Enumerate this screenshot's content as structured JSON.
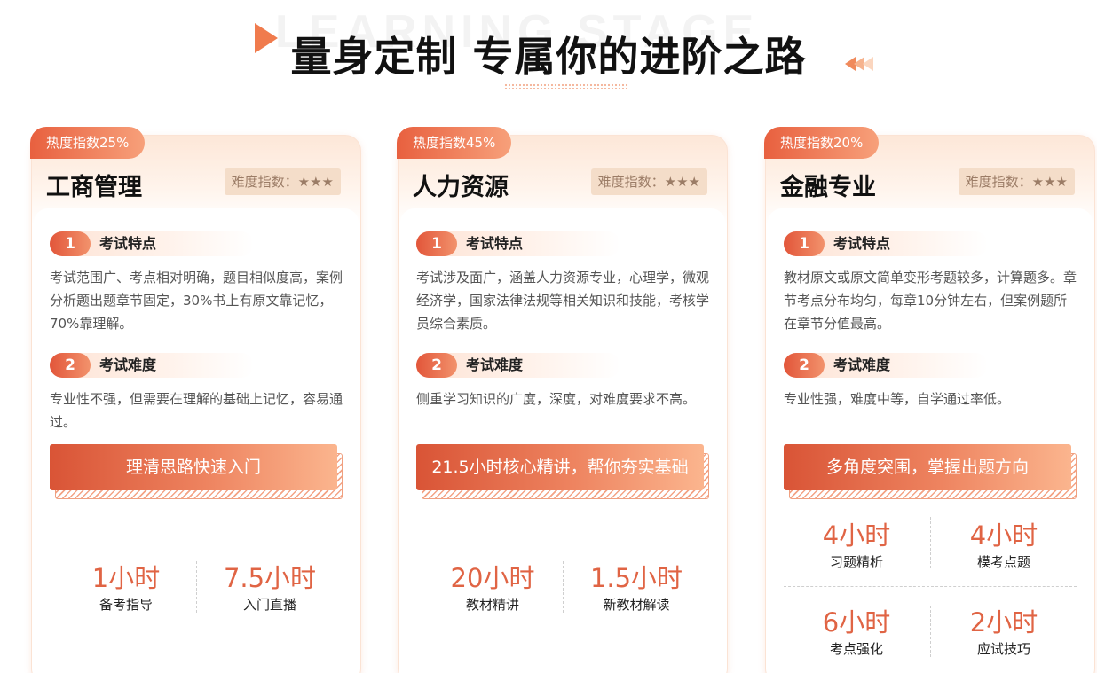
{
  "header": {
    "watermark": "LEARNING STAGE",
    "title": "量身定制 专属你的进阶之路"
  },
  "cards": [
    {
      "heat": "热度指数25%",
      "name": "工商管理",
      "difficulty": "难度指数：★★★",
      "sections": [
        {
          "num": "1",
          "title": "考试特点",
          "text": "考试范围广、考点相对明确，题目相似度高，案例分析题出题章节固定，30%书上有原文靠记忆，70%靠理解。"
        },
        {
          "num": "2",
          "title": "考试难度",
          "text": "专业性不强，但需要在理解的基础上记忆，容易通过。"
        }
      ],
      "button": "理清思路快速入门",
      "stats": [
        {
          "value": "1小时",
          "label": "备考指导"
        },
        {
          "value": "7.5小时",
          "label": "入门直播"
        }
      ]
    },
    {
      "heat": "热度指数45%",
      "name": "人力资源",
      "difficulty": "难度指数：★★★",
      "sections": [
        {
          "num": "1",
          "title": "考试特点",
          "text": "考试涉及面广，涵盖人力资源专业，心理学，微观经济学，国家法律法规等相关知识和技能，考核学员综合素质。"
        },
        {
          "num": "2",
          "title": "考试难度",
          "text": "侧重学习知识的广度，深度，对难度要求不高。"
        }
      ],
      "button": "21.5小时核心精讲，帮你夯实基础",
      "stats": [
        {
          "value": "20小时",
          "label": "教材精讲"
        },
        {
          "value": "1.5小时",
          "label": "新教材解读"
        }
      ]
    },
    {
      "heat": "热度指数20%",
      "name": "金融专业",
      "difficulty": "难度指数：★★★",
      "sections": [
        {
          "num": "1",
          "title": "考试特点",
          "text": "教材原文或原文简单变形考题较多，计算题多。章节考点分布均匀，每章10分钟左右，但案例题所在章节分值最高。"
        },
        {
          "num": "2",
          "title": "考试难度",
          "text": "专业性强，难度中等，自学通过率低。"
        }
      ],
      "button": "多角度突围，掌握出题方向",
      "stats": [
        {
          "value": "4小时",
          "label": "习题精析"
        },
        {
          "value": "4小时",
          "label": "模考点题"
        },
        {
          "value": "6小时",
          "label": "考点强化"
        },
        {
          "value": "2小时",
          "label": "应试技巧"
        }
      ]
    }
  ]
}
